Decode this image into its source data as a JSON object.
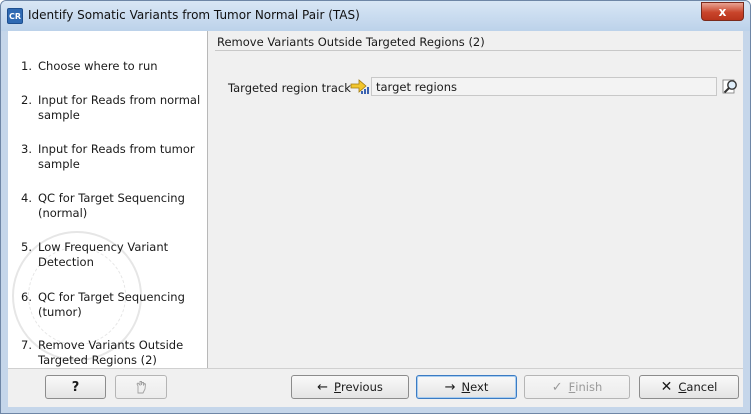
{
  "window": {
    "icon_text": "CR",
    "title": "Identify Somatic Variants from Tumor Normal Pair (TAS)",
    "close_glyph": "x"
  },
  "steps": [
    {
      "num": "1.",
      "label": "Choose where to run"
    },
    {
      "num": "2.",
      "label": "Input for Reads from normal sample"
    },
    {
      "num": "3.",
      "label": "Input for Reads from tumor sample"
    },
    {
      "num": "4.",
      "label": "QC for Target Sequencing (normal)"
    },
    {
      "num": "5.",
      "label": "Low Frequency Variant Detection"
    },
    {
      "num": "6.",
      "label": "QC for Target Sequencing (tumor)"
    },
    {
      "num": "7.",
      "label": "Remove Variants Outside Targeted Regions (2)"
    }
  ],
  "main": {
    "section_title": "Remove Variants Outside Targeted Regions (2)",
    "field_label": "Targeted region track",
    "field_value": "target regions",
    "track_icon": "annotation-track-icon",
    "browse_icon": "browse-icon"
  },
  "buttons": {
    "help": "?",
    "previous_first": "P",
    "previous_rest": "revious",
    "next_first": "N",
    "next_rest": "ext",
    "finish_first": "F",
    "finish_rest": "inish",
    "cancel_first": "C",
    "cancel_rest": "ancel"
  },
  "colors": {
    "accent": "#3b7bc3",
    "cancel_icon": "#1a1a1a",
    "title_bar": "#c5d6ea"
  }
}
